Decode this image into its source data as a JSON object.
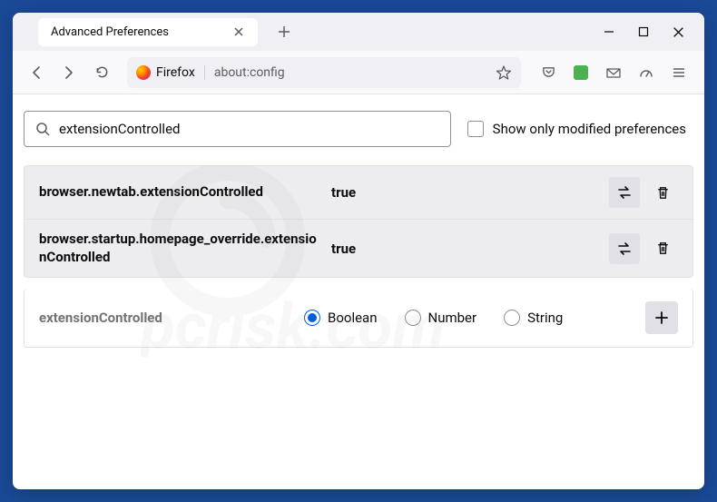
{
  "tab": {
    "title": "Advanced Preferences"
  },
  "urlbar": {
    "identity_label": "Firefox",
    "url": "about:config"
  },
  "content": {
    "search_value": "extensionControlled",
    "checkbox_label": "Show only modified preferences",
    "prefs": [
      {
        "name": "browser.newtab.extensionControlled",
        "value": "true"
      },
      {
        "name": "browser.startup.homepage_override.extensionControlled",
        "value": "true"
      }
    ],
    "add": {
      "name": "extensionControlled",
      "options": {
        "boolean": "Boolean",
        "number": "Number",
        "string": "String"
      }
    }
  },
  "watermark": {
    "text": "pcrisk.com"
  }
}
